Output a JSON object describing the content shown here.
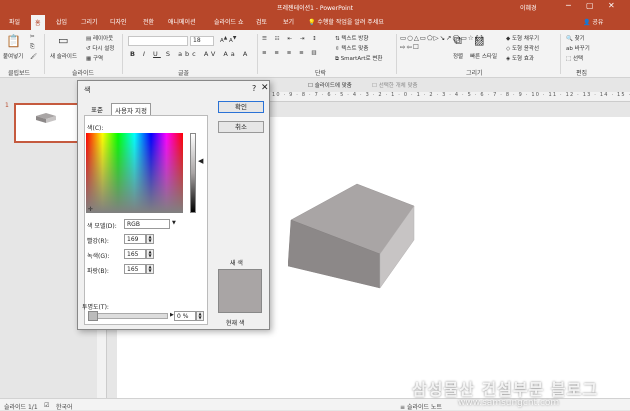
{
  "app": {
    "doc_title": "프레젠테이션1 - PowerPoint",
    "user": "이혜경",
    "share": "공유"
  },
  "tabs": [
    "파일",
    "홈",
    "삽입",
    "그리기",
    "디자인",
    "전환",
    "애니메이션",
    "슬라이드 쇼",
    "검토",
    "보기",
    "수행할 작업을 알려 주세요"
  ],
  "active_tab_index": 1,
  "ribbon": {
    "clipboard_label": "클립보드",
    "paste": "붙여넣기",
    "slides_label": "슬라이드",
    "new_slide": "새 슬라이드",
    "layout": "레이아웃",
    "reset": "다시 설정",
    "section": "구역",
    "font_label": "글꼴",
    "font_size": "18",
    "paragraph_label": "단락",
    "text_direction": "텍스트 방향",
    "align_text": "텍스트 맞춤",
    "smartart": "SmartArt로 변환",
    "drawing_label": "그리기",
    "arrange": "정렬",
    "quick_styles": "빠른 스타일",
    "shape_fill": "도형 채우기",
    "shape_outline": "도형 윤곽선",
    "shape_effects": "도형 효과",
    "editing_label": "편집",
    "find": "찾기",
    "replace": "바꾸기",
    "select": "선택"
  },
  "option_bar": {
    "fit_slide": "슬라이드에 맞춤",
    "fit_selected": "선택한 개체 맞춤"
  },
  "ruler_text": "10 · 9 · 8 · 7 · 6 · 5 · 4 · 3 · 2 · 1 · 0 · 1 · 2 · 3 · 4 · 5 · 6 · 7 · 8 · 9 · 10 · 11 · 12 · 13 · 14 · 15 · 16",
  "slides_pane": {
    "slide_number": "1"
  },
  "dialog": {
    "title": "색",
    "help": "?",
    "close": "✕",
    "tab_standard": "표준",
    "tab_custom": "사용자 지정",
    "colors_label": "색(C):",
    "color_model_label": "색 모델(D):",
    "color_model_value": "RGB",
    "red_label": "빨강(R):",
    "red_value": "169",
    "green_label": "녹색(G):",
    "green_value": "165",
    "blue_label": "파랑(B):",
    "blue_value": "165",
    "transparency_label": "투명도(T):",
    "transparency_value": "0 %",
    "ok": "확인",
    "cancel": "취소",
    "new_label": "새 색",
    "current_label": "현재 색",
    "swatch_color": "#a9a5a5",
    "transparency": 0
  },
  "statusbar": {
    "slide_info": "슬라이드 1/1",
    "language": "한국어",
    "notes": "슬라이드 노트"
  },
  "watermark": {
    "text": "삼성물산 건설부문 블로그",
    "url": "www.samsungcnt.com"
  },
  "colors": {
    "accent": "#b7472a",
    "box_top": "#a9a5a5",
    "box_front": "#8c8888",
    "box_side": "#c7c4c4"
  }
}
